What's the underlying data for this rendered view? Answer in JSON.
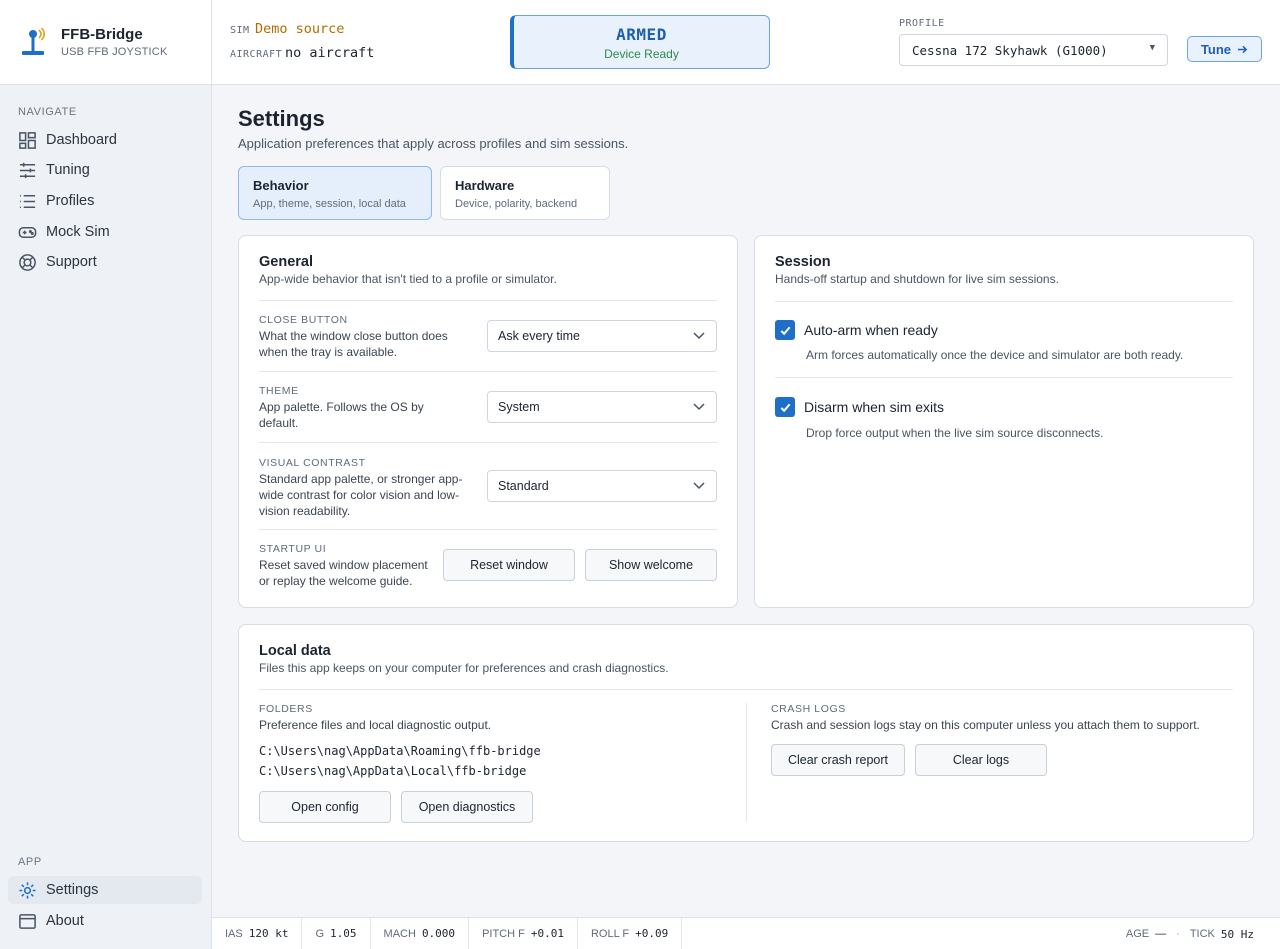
{
  "brand": {
    "title": "FFB-Bridge",
    "subtitle": "USB FFB JOYSTICK"
  },
  "sidebar": {
    "navigate_label": "NAVIGATE",
    "items": [
      {
        "label": "Dashboard",
        "icon": "dashboard-icon"
      },
      {
        "label": "Tuning",
        "icon": "sliders-icon"
      },
      {
        "label": "Profiles",
        "icon": "list-icon"
      },
      {
        "label": "Mock Sim",
        "icon": "gamepad-icon"
      },
      {
        "label": "Support",
        "icon": "lifebuoy-icon"
      }
    ],
    "app_label": "APP",
    "app_items": [
      {
        "label": "Settings",
        "icon": "gear-icon",
        "active": true
      },
      {
        "label": "About",
        "icon": "window-icon"
      }
    ]
  },
  "topbar": {
    "sim_label": "SIM",
    "sim_value": "Demo source",
    "aircraft_label": "AIRCRAFT",
    "aircraft_value": "no aircraft",
    "status_title": "ARMED",
    "status_sub": "Device Ready",
    "profile_label": "PROFILE",
    "profile_value": "Cessna 172 Skyhawk (G1000)",
    "tune_label": "Tune"
  },
  "page": {
    "title": "Settings",
    "subtitle": "Application preferences that apply across profiles and sim sessions.",
    "tabs": [
      {
        "title": "Behavior",
        "sub": "App, theme, session, local data"
      },
      {
        "title": "Hardware",
        "sub": "Device, polarity, backend"
      }
    ]
  },
  "general": {
    "title": "General",
    "subtitle": "App-wide behavior that isn't tied to a profile or simulator.",
    "rows": [
      {
        "label": "CLOSE BUTTON",
        "desc": "What the window close button does when the tray is available.",
        "value": "Ask every time"
      },
      {
        "label": "THEME",
        "desc": "App palette. Follows the OS by default.",
        "value": "System"
      },
      {
        "label": "VISUAL CONTRAST",
        "desc": "Standard app palette, or stronger app-wide contrast for color vision and low-vision readability.",
        "value": "Standard"
      }
    ],
    "startup": {
      "label": "STARTUP UI",
      "desc": "Reset saved window placement or replay the welcome guide.",
      "reset_label": "Reset window",
      "welcome_label": "Show welcome"
    }
  },
  "session": {
    "title": "Session",
    "subtitle": "Hands-off startup and shutdown for live sim sessions.",
    "items": [
      {
        "label": "Auto-arm when ready",
        "desc": "Arm forces automatically once the device and simulator are both ready.",
        "checked": true
      },
      {
        "label": "Disarm when sim exits",
        "desc": "Drop force output when the live sim source disconnects.",
        "checked": true
      }
    ]
  },
  "local_data": {
    "title": "Local data",
    "subtitle": "Files this app keeps on your computer for preferences and crash diagnostics.",
    "folders_label": "FOLDERS",
    "folders_desc": "Preference files and local diagnostic output.",
    "paths": [
      "C:\\Users\\nag\\AppData\\Roaming\\ffb-bridge",
      "C:\\Users\\nag\\AppData\\Local\\ffb-bridge"
    ],
    "open_config_label": "Open config",
    "open_diag_label": "Open diagnostics",
    "crash_label": "CRASH LOGS",
    "crash_desc": "Crash and session logs stay on this computer unless you attach them to support.",
    "clear_crash_label": "Clear crash report",
    "clear_logs_label": "Clear logs"
  },
  "statusbar": {
    "items": [
      {
        "k": "IAS",
        "v": "120 kt"
      },
      {
        "k": "G",
        "v": "1.05"
      },
      {
        "k": "MACH",
        "v": "0.000"
      },
      {
        "k": "PITCH F",
        "v": "+0.01"
      },
      {
        "k": "ROLL F",
        "v": "+0.09"
      }
    ],
    "age_label": "AGE",
    "age_value": "—",
    "dot": "·",
    "tick_label": "TICK",
    "tick_value": "50 Hz"
  },
  "colors": {
    "accent": "#1f6ec8",
    "armed_bg": "#e8f1fc",
    "ready_green": "#2f8a4a",
    "sim_value": "#b86a00"
  }
}
